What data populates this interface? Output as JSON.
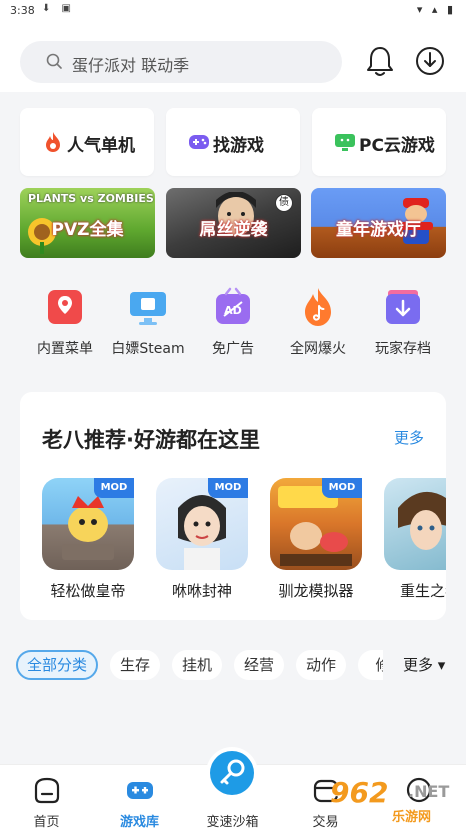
{
  "status_bar": {
    "time": "3:38",
    "left_icons": "⬇ ▣",
    "right_icons": "▾ ▴ ▮"
  },
  "search": {
    "placeholder": "蛋仔派对 联动季",
    "icon": "search-icon"
  },
  "header_icons": [
    "bell-icon",
    "download-icon"
  ],
  "top_cards": [
    {
      "label": "人气单机",
      "icon": "flame-icon",
      "color": "#f0522d"
    },
    {
      "label": "找游戏",
      "icon": "gamepad-icon",
      "color": "#7b5cf0"
    },
    {
      "label": "PC云游戏",
      "icon": "monitor-icon",
      "color": "#3ac25c"
    }
  ],
  "banners": [
    {
      "label": "PVZ全集",
      "top_text": "PLANTS vs ZOMBIES"
    },
    {
      "label": "屌丝逆袭",
      "badge": "债"
    },
    {
      "label": "童年游戏厅"
    }
  ],
  "quick_items": [
    {
      "label": "内置菜单",
      "icon": "menu-icon",
      "color": "#f04a4a"
    },
    {
      "label": "白嫖Steam",
      "icon": "steam-icon",
      "color": "#4aa8f0"
    },
    {
      "label": "免广告",
      "icon": "no-ads-icon",
      "color": "#9a6cf0"
    },
    {
      "label": "全网爆火",
      "icon": "fire-icon",
      "color": "#ff7a2e"
    },
    {
      "label": "玩家存档",
      "icon": "save-icon",
      "color": "#7a6cf0"
    }
  ],
  "recommend": {
    "title": "老八推荐·好游都在这里",
    "more": "更多",
    "games": [
      {
        "label": "轻松做皇帝",
        "badge": "MOD"
      },
      {
        "label": "咻咻封神",
        "badge": "MOD"
      },
      {
        "label": "驯龙模拟器",
        "badge": "MOD"
      },
      {
        "label": "重生之我",
        "badge": ""
      }
    ]
  },
  "categories": [
    "全部分类",
    "生存",
    "挂机",
    "经营",
    "动作",
    "修"
  ],
  "categories_more": "更多 ▾",
  "tabs": [
    {
      "label": "首页",
      "icon": "home-icon"
    },
    {
      "label": "游戏库",
      "icon": "game-library-icon"
    },
    {
      "label": "变速沙箱",
      "icon": "key-icon"
    },
    {
      "label": "交易",
      "icon": "trade-icon"
    },
    {
      "label": "",
      "icon": "profile-icon"
    }
  ],
  "watermark": {
    "num": "962",
    "net": ".NET",
    "sub": "乐游网"
  },
  "colors": {
    "accent": "#2a8ae0",
    "fab": "#1e9be6"
  }
}
